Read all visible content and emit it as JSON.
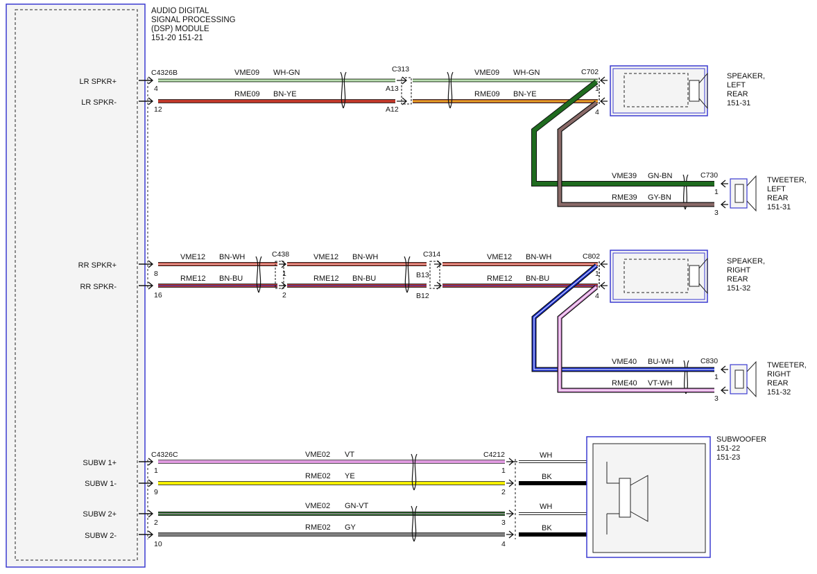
{
  "module": {
    "title_lines": [
      "AUDIO DIGITAL",
      "SIGNAL PROCESSING",
      "(DSP) MODULE",
      "151-20   151-21"
    ],
    "pins": {
      "lr_pos": "LR SPKR+",
      "lr_neg": "LR SPKR-",
      "rr_pos": "RR SPKR+",
      "rr_neg": "RR SPKR-",
      "sub1_pos": "SUBW 1+",
      "sub1_neg": "SUBW 1-",
      "sub2_pos": "SUBW 2+",
      "sub2_neg": "SUBW 2-"
    }
  },
  "connectors": {
    "c4326b": "C4326B",
    "c313": "C313",
    "c702": "C702",
    "c730": "C730",
    "c438": "C438",
    "c314": "C314",
    "c802": "C802",
    "c830": "C830",
    "c4326c": "C4326C",
    "c4212": "C4212"
  },
  "pin_numbers": {
    "lr_pos_mod": "4",
    "lr_neg_mod": "12",
    "c313_a13": "A13",
    "c313_a12": "A12",
    "c702_1": "1",
    "c702_4": "4",
    "c730_1": "1",
    "c730_3": "3",
    "rr_pos_mod": "8",
    "rr_neg_mod": "16",
    "c438_1": "1",
    "c438_2": "2",
    "c314_b13": "B13",
    "c314_b12": "B12",
    "c802_1": "1",
    "c802_4": "4",
    "c830_1": "1",
    "c830_3": "3",
    "sub1_pos_mod": "1",
    "sub1_neg_mod": "9",
    "sub2_pos_mod": "2",
    "sub2_neg_mod": "10",
    "c4212_1": "1",
    "c4212_2": "2",
    "c4212_3": "3",
    "c4212_4": "4"
  },
  "wires": {
    "vme09": "VME09",
    "wh_gn": "WH-GN",
    "rme09": "RME09",
    "bn_ye": "BN-YE",
    "vme39": "VME39",
    "gn_bn": "GN-BN",
    "rme39": "RME39",
    "gy_bn": "GY-BN",
    "vme12": "VME12",
    "bn_wh": "BN-WH",
    "rme12": "RME12",
    "bn_bu": "BN-BU",
    "vme40": "VME40",
    "bu_wh": "BU-WH",
    "rme40": "RME40",
    "vt_wh": "VT-WH",
    "vme02": "VME02",
    "rme02": "RME02",
    "vt": "VT",
    "ye": "YE",
    "gn_vt": "GN-VT",
    "gy": "GY",
    "wh": "WH",
    "bk": "BK"
  },
  "components": {
    "lr_speaker": [
      "SPEAKER,",
      "LEFT",
      "REAR",
      "151-31"
    ],
    "lr_tweeter": [
      "TWEETER,",
      "LEFT",
      "REAR",
      "151-31"
    ],
    "rr_speaker": [
      "SPEAKER,",
      "RIGHT",
      "REAR",
      "151-32"
    ],
    "rr_tweeter": [
      "TWEETER,",
      "RIGHT",
      "REAR",
      "151-32"
    ],
    "subwoofer": [
      "SUBWOOFER",
      "151-22",
      "151-23"
    ]
  },
  "colors": {
    "module_border": "#3a3ad0",
    "green": "#1f6b1f",
    "white": "#ffffff",
    "brown": "#8b3a1a",
    "yellow": "#e8c020",
    "red_brown": "#c0392b",
    "blue": "#1a2fd0",
    "violet": "#e09ae0",
    "gray": "#808080",
    "gray_brown": "#7a6a68",
    "yellow_line": "#f5f000",
    "black": "#000000"
  }
}
